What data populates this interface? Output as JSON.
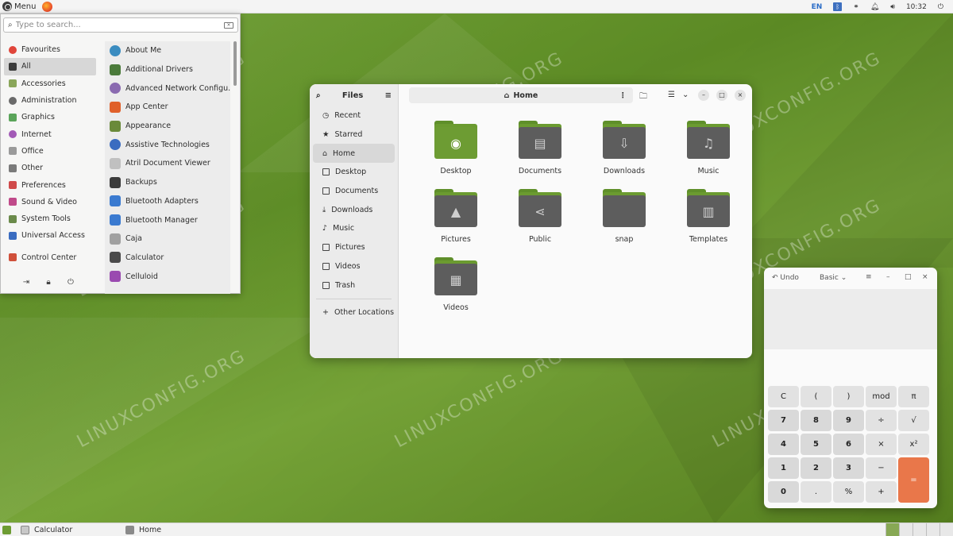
{
  "top_panel": {
    "menu_label": "Menu",
    "lang": "EN",
    "time": "10:32"
  },
  "menu": {
    "search_placeholder": "Type to search...",
    "categories": [
      {
        "label": "Favourites",
        "color": "#e0453a"
      },
      {
        "label": "All",
        "color": "#3a3a3a"
      },
      {
        "label": "Accessories",
        "color": "#8aa65a"
      },
      {
        "label": "Administration",
        "color": "#6a6a6a"
      },
      {
        "label": "Graphics",
        "color": "#5aa45a"
      },
      {
        "label": "Internet",
        "color": "#a25ab6"
      },
      {
        "label": "Office",
        "color": "#9a9a9a"
      },
      {
        "label": "Other",
        "color": "#7a7a7a"
      },
      {
        "label": "Preferences",
        "color": "#d04a4a"
      },
      {
        "label": "Sound & Video",
        "color": "#c04a8a"
      },
      {
        "label": "System Tools",
        "color": "#6a8a4a"
      },
      {
        "label": "Universal Access",
        "color": "#3a6cc0"
      },
      {
        "label": "Control Center",
        "color": "#d0503a"
      }
    ],
    "apps": [
      {
        "label": "About Me",
        "color": "#3a8cc0"
      },
      {
        "label": "Additional Drivers",
        "color": "#4a7a3a"
      },
      {
        "label": "Advanced Network Configu...",
        "color": "#8a6ab0"
      },
      {
        "label": "App Center",
        "color": "#e0602a"
      },
      {
        "label": "Appearance",
        "color": "#6a8a3a"
      },
      {
        "label": "Assistive Technologies",
        "color": "#3a6cc0"
      },
      {
        "label": "Atril Document Viewer",
        "color": "#c0c0c0"
      },
      {
        "label": "Backups",
        "color": "#3a3a3a"
      },
      {
        "label": "Bluetooth Adapters",
        "color": "#3a7ad0"
      },
      {
        "label": "Bluetooth Manager",
        "color": "#3a7ad0"
      },
      {
        "label": "Caja",
        "color": "#a0a0a0"
      },
      {
        "label": "Calculator",
        "color": "#4a4a4a"
      },
      {
        "label": "Celluloid",
        "color": "#9a4ab0"
      }
    ]
  },
  "files": {
    "title": "Files",
    "location": "Home",
    "sidebar": [
      {
        "label": "Recent",
        "icon": "clock-icon"
      },
      {
        "label": "Starred",
        "icon": "star-icon"
      },
      {
        "label": "Home",
        "icon": "home-icon"
      },
      {
        "label": "Desktop",
        "icon": "desktop-icon"
      },
      {
        "label": "Documents",
        "icon": "document-icon"
      },
      {
        "label": "Downloads",
        "icon": "download-icon"
      },
      {
        "label": "Music",
        "icon": "music-icon"
      },
      {
        "label": "Pictures",
        "icon": "picture-icon"
      },
      {
        "label": "Videos",
        "icon": "video-icon"
      },
      {
        "label": "Trash",
        "icon": "trash-icon"
      }
    ],
    "other_locations": "Other Locations",
    "folders": [
      {
        "label": "Desktop",
        "icon": "desktop-folder-icon"
      },
      {
        "label": "Documents",
        "icon": "documents-folder-icon"
      },
      {
        "label": "Downloads",
        "icon": "downloads-folder-icon"
      },
      {
        "label": "Music",
        "icon": "music-folder-icon"
      },
      {
        "label": "Pictures",
        "icon": "pictures-folder-icon"
      },
      {
        "label": "Public",
        "icon": "public-folder-icon"
      },
      {
        "label": "snap",
        "icon": "snap-folder-icon"
      },
      {
        "label": "Templates",
        "icon": "templates-folder-icon"
      },
      {
        "label": "Videos",
        "icon": "videos-folder-icon"
      }
    ]
  },
  "calculator": {
    "undo": "Undo",
    "mode": "Basic",
    "buttons": {
      "clear": "C",
      "lparen": "(",
      "rparen": ")",
      "mod": "mod",
      "pi": "π",
      "d7": "7",
      "d8": "8",
      "d9": "9",
      "div": "÷",
      "sqrt": "√",
      "d4": "4",
      "d5": "5",
      "d6": "6",
      "mul": "×",
      "sq": "x²",
      "d1": "1",
      "d2": "2",
      "d3": "3",
      "sub": "−",
      "eq": "=",
      "d0": "0",
      "dot": ".",
      "pct": "%",
      "add": "+"
    }
  },
  "taskbar": {
    "tasks": [
      {
        "label": "Calculator"
      },
      {
        "label": "Home"
      }
    ]
  },
  "watermark": "LINUXCONFIG.ORG"
}
